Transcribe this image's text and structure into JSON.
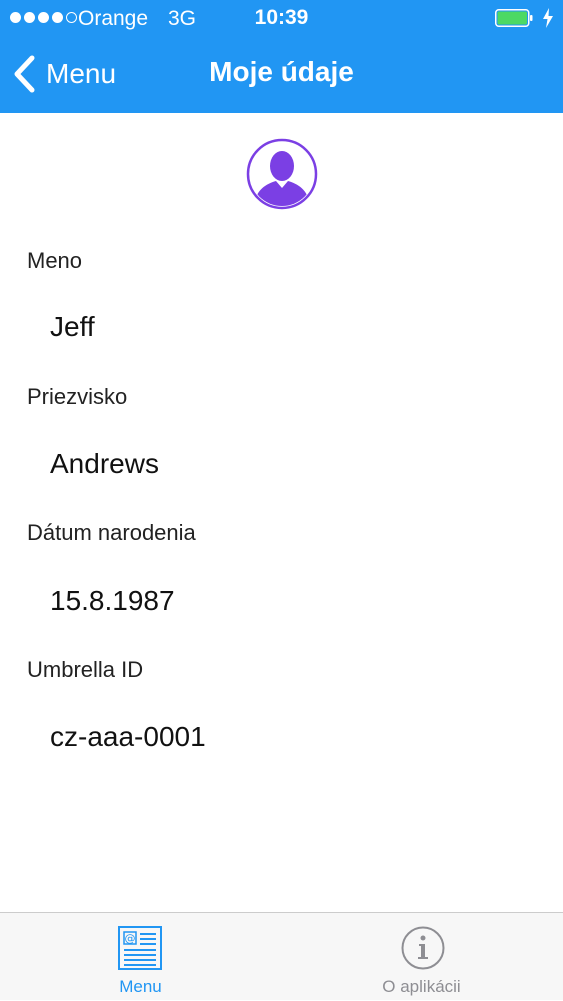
{
  "status_bar": {
    "carrier": "Orange",
    "network": "3G",
    "time": "10:39",
    "battery_icon": "battery-charging-icon"
  },
  "nav": {
    "back_label": "Menu",
    "title": "Moje údaje"
  },
  "profile": {
    "avatar_icon": "user-avatar-icon",
    "accent_color": "#7b3fe4",
    "fields": [
      {
        "label": "Meno",
        "value": "Jeff"
      },
      {
        "label": "Priezvisko",
        "value": "Andrews"
      },
      {
        "label": "Dátum narodenia",
        "value": "15.8.1987"
      },
      {
        "label": "Umbrella ID",
        "value": "cz-aaa-0001"
      }
    ]
  },
  "tabs": [
    {
      "label": "Menu",
      "icon": "newsletter-icon",
      "active": true
    },
    {
      "label": "O aplikácii",
      "icon": "info-icon",
      "active": false
    }
  ],
  "colors": {
    "primary": "#2196f3",
    "inactive": "#8e8e93",
    "battery": "#4cd964"
  }
}
